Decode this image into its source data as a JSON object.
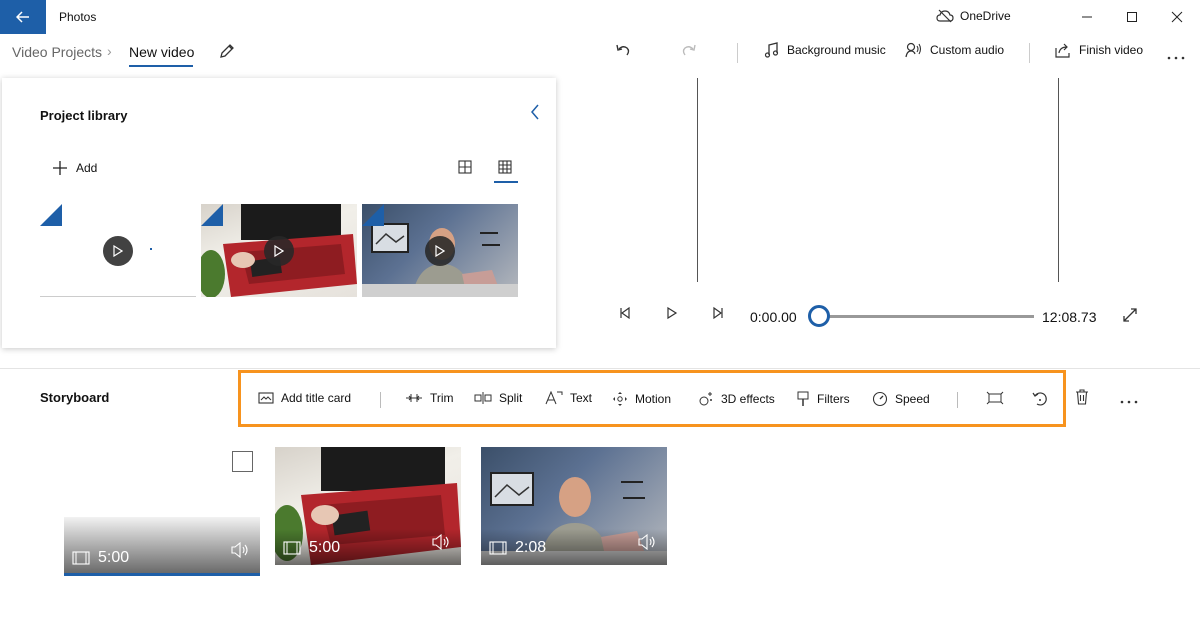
{
  "titlebar": {
    "app_name": "Photos",
    "onedrive_label": "OneDrive"
  },
  "breadcrumb": {
    "root": "Video Projects",
    "current": "New video"
  },
  "commands": {
    "background_music": "Background music",
    "custom_audio": "Custom audio",
    "finish_video": "Finish video"
  },
  "library": {
    "title": "Project library",
    "add_label": "Add"
  },
  "playback": {
    "current_time": "0:00.00",
    "total_time": "12:08.73",
    "progress": 0.0
  },
  "storyboard": {
    "title": "Storyboard",
    "tools": {
      "add_title_card": "Add title card",
      "trim": "Trim",
      "split": "Split",
      "text": "Text",
      "motion": "Motion",
      "effects_3d": "3D effects",
      "filters": "Filters",
      "speed": "Speed"
    },
    "clips": [
      {
        "duration": "5:00"
      },
      {
        "duration": "5:00"
      },
      {
        "duration": "2:08"
      }
    ]
  },
  "colors": {
    "accent": "#1e5fa8",
    "highlight": "#f7931e"
  }
}
